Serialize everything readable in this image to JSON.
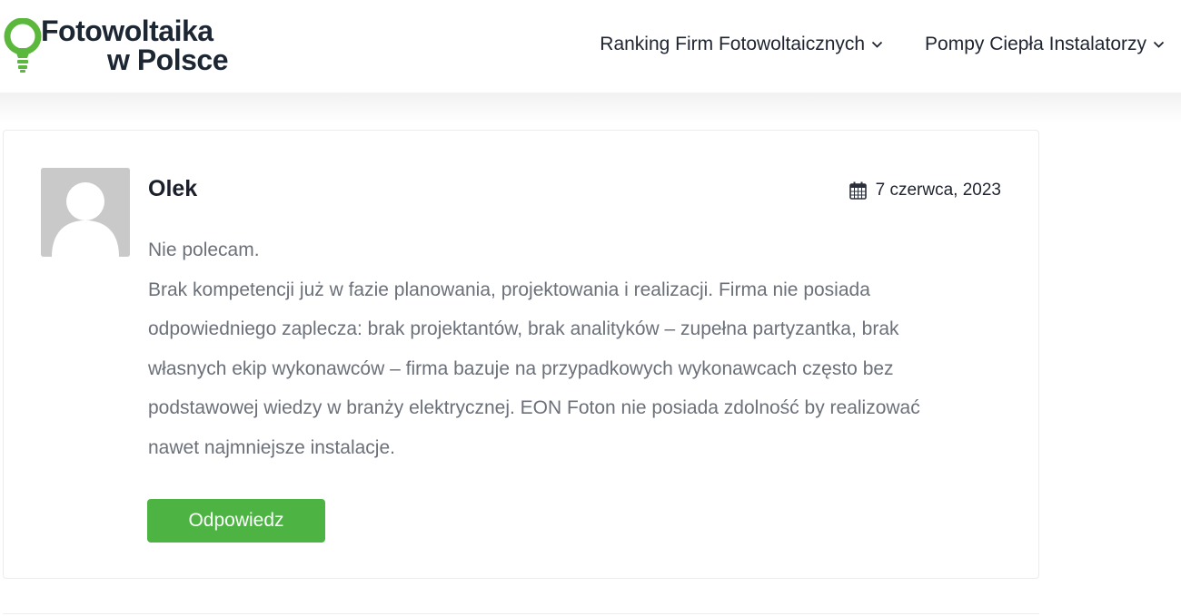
{
  "header": {
    "logo": {
      "line1": "Fotowoltaika",
      "line2": "w Polsce",
      "bulb_color": "#5cb83c"
    },
    "nav": [
      {
        "label": "Ranking Firm Fotowoltaicznych",
        "icon": "chevron-down-icon"
      },
      {
        "label": "Pompy Ciepła Instalatorzy",
        "icon": "chevron-down-icon"
      }
    ]
  },
  "comment": {
    "author": "Olek",
    "date": "7 czerwca, 2023",
    "date_icon": "calendar-icon",
    "avatar_icon": "default-avatar-icon",
    "lines": [
      "Nie polecam.",
      "Brak kompetencji już w fazie planowania, projektowania i realizacji. Firma nie posiada",
      "odpowiedniego zaplecza: brak projektantów, brak analityków – zupełna partyzantka, brak",
      "własnych ekip wykonawców – firma bazuje na przypadkowych wykonawcach często bez",
      "podstawowej wiedzy w branży elektrycznej. EON Foton nie posiada zdolność by realizować",
      "nawet najmniejsze instalacje."
    ],
    "reply_label": "Odpowiedz",
    "reply_color": "#4db444"
  }
}
